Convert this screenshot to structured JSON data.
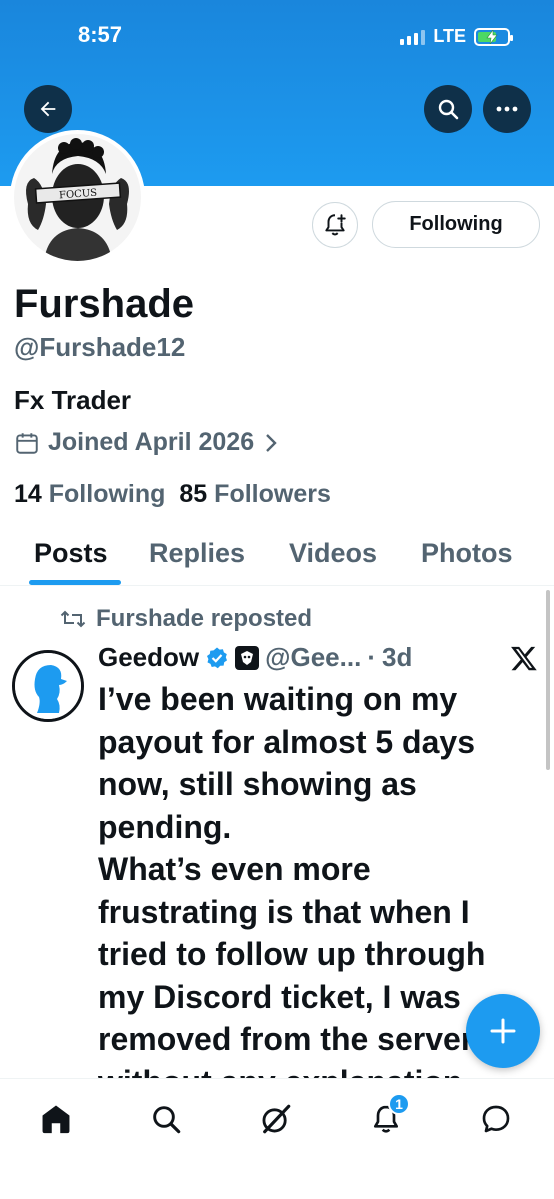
{
  "status_bar": {
    "time": "8:57",
    "network": "LTE"
  },
  "profile": {
    "name": "Furshade",
    "handle": "@Furshade12",
    "bio": "Fx Trader",
    "joined": "Joined April 2026",
    "following_count": "14",
    "following_label": "Following",
    "followers_count": "85",
    "followers_label": "Followers",
    "follow_button": "Following",
    "avatar_text": "FOCUS"
  },
  "tabs": [
    {
      "label": "Posts",
      "active": true
    },
    {
      "label": "Replies",
      "active": false
    },
    {
      "label": "Videos",
      "active": false
    },
    {
      "label": "Photos",
      "active": false
    }
  ],
  "post": {
    "repost_label": "Furshade reposted",
    "author_name": "Geedow",
    "author_handle": "@Gee...",
    "separator": "·",
    "time": "3d",
    "text": "I’ve been waiting on my\npayout for almost 5 days\nnow, still showing as\npending.\nWhat’s even more\nfrustrating is that when I\ntried to follow up through\nmy Discord ticket, I was\nremoved from the server\nwithout any explanation"
  },
  "bottom_nav": {
    "notification_count": "1"
  },
  "colors": {
    "accent": "#1d9bf0",
    "text": "#0f1419",
    "secondary": "#536471"
  },
  "icons": [
    "back-arrow-icon",
    "search-icon",
    "more-icon",
    "notification-add-icon",
    "calendar-icon",
    "chevron-right-icon",
    "repost-icon",
    "verified-icon",
    "x-logo-icon",
    "plus-icon",
    "home-icon",
    "grok-icon",
    "bell-icon",
    "messages-icon"
  ]
}
